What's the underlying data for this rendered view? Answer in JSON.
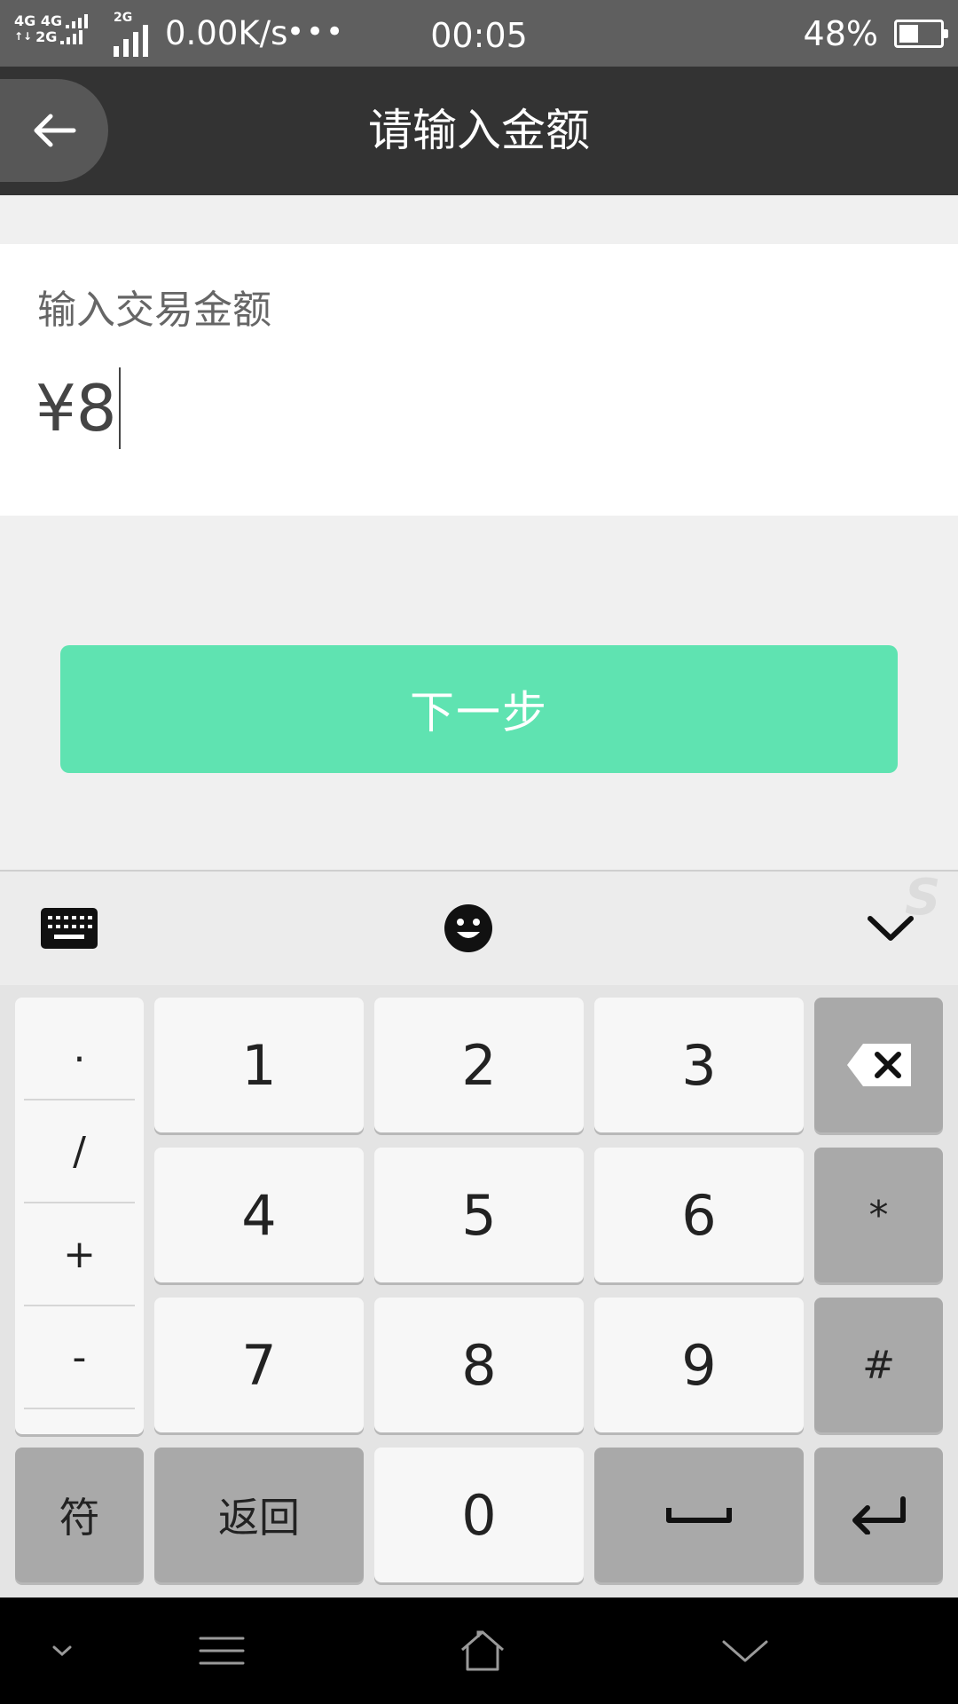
{
  "status_bar": {
    "net_line1": "4G 4G",
    "net_line2": "2G",
    "net_small": "2G",
    "speed": "0.00K/s",
    "dots": "•••",
    "time": "00:05",
    "battery_pct": "48%",
    "battery_level": 0.48
  },
  "header": {
    "title": "请输入金额",
    "back_icon": "arrow-left-icon"
  },
  "amount": {
    "label": "输入交易金额",
    "value": "¥8"
  },
  "next_button": {
    "label": "下一步",
    "color": "#5fe3b1"
  },
  "keyboard_toolbar": {
    "left_icon": "keyboard-icon",
    "center_icon": "smiley-icon",
    "right_icon": "chevron-down-icon",
    "watermark": "S"
  },
  "keyboard": {
    "symbols": [
      ".",
      "/",
      "+",
      "-"
    ],
    "digits": [
      "1",
      "2",
      "3",
      "4",
      "5",
      "6",
      "7",
      "8",
      "9"
    ],
    "right_keys": [
      "*",
      "#"
    ],
    "bottom": {
      "symbol_key": "符",
      "back_key": "返回",
      "zero_key": "0"
    }
  },
  "nav_bar": {
    "icons": [
      "small-chevron-down-icon",
      "menu-icon",
      "home-icon",
      "chevron-down-icon"
    ]
  }
}
